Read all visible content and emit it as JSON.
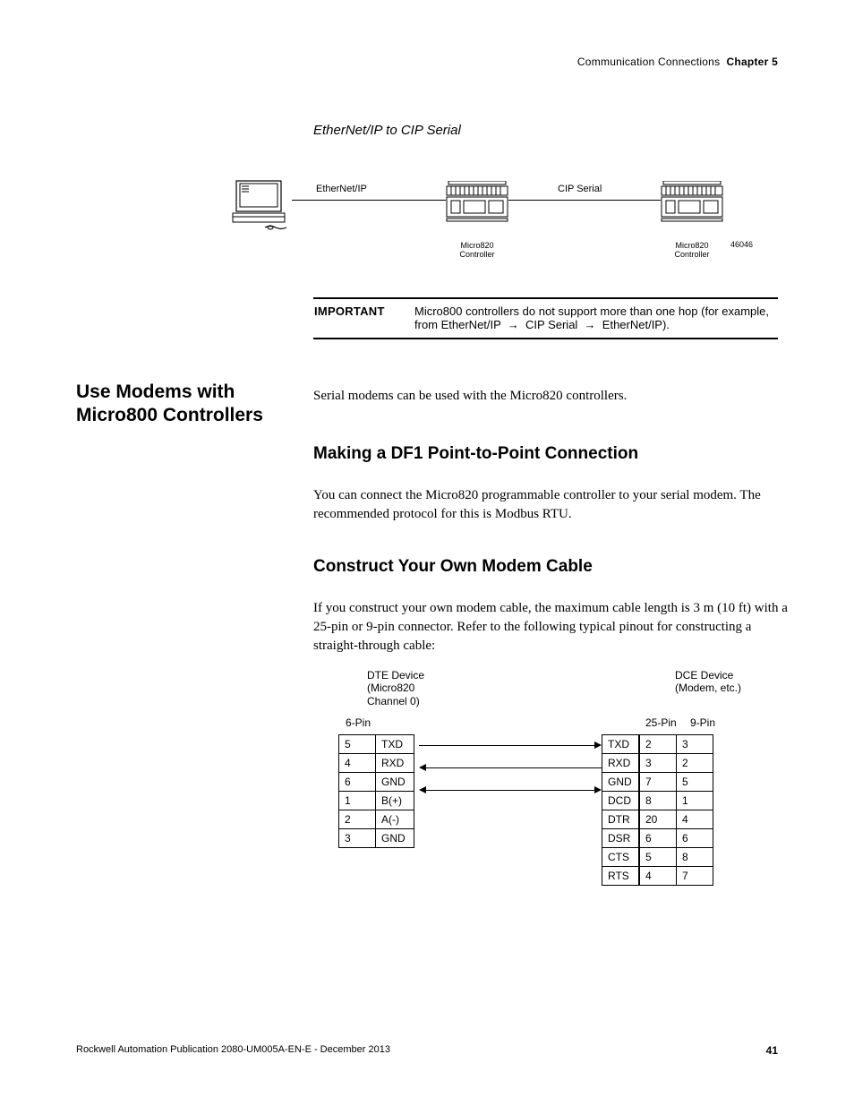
{
  "header": {
    "section": "Communication Connections",
    "chapter_label": "Chapter 5"
  },
  "figure": {
    "title": "EtherNet/IP to CIP Serial",
    "link1": "EtherNet/IP",
    "link2": "CIP Serial",
    "controller_label": "Micro820\nController",
    "ref_id": "46046"
  },
  "important": {
    "label": "IMPORTANT",
    "text_a": "Micro800 controllers do not support more than one hop (for example,",
    "text_b_pre": "from EtherNet/IP ",
    "text_b_mid": " CIP Serial ",
    "text_b_post": " EtherNet/IP)."
  },
  "section": {
    "title": "Use Modems with Micro800 Controllers"
  },
  "intro": "Serial modems can be used with the Micro820 controllers.",
  "h2a": "Making a DF1 Point-to-Point Connection",
  "pa": "You can connect the Micro820 programmable controller to your serial modem. The recommended protocol for this is Modbus RTU.",
  "h2b": "Construct Your Own Modem Cable",
  "pb": "If you construct your own modem cable, the maximum cable length is 3 m (10 ft) with a 25-pin or 9-pin connector. Refer to the following typical pinout for constructing a straight-through cable:",
  "pinout": {
    "dte_label": "DTE Device\n(Micro820\nChannel 0)",
    "dce_label": "DCE Device\n(Modem, etc.)",
    "col_6pin": "6-Pin",
    "col_25pin": "25-Pin",
    "col_9pin": "9-Pin",
    "left_rows": [
      {
        "pin": "5",
        "sig": "TXD"
      },
      {
        "pin": "4",
        "sig": "RXD"
      },
      {
        "pin": "6",
        "sig": "GND"
      },
      {
        "pin": "1",
        "sig": "B(+)"
      },
      {
        "pin": "2",
        "sig": "A(-)"
      },
      {
        "pin": "3",
        "sig": "GND"
      }
    ],
    "mid_rows": [
      "TXD",
      "RXD",
      "GND",
      "DCD",
      "DTR",
      "DSR",
      "CTS",
      "RTS"
    ],
    "right_rows": [
      {
        "p25": "2",
        "p9": "3"
      },
      {
        "p25": "3",
        "p9": "2"
      },
      {
        "p25": "7",
        "p9": "5"
      },
      {
        "p25": "8",
        "p9": "1"
      },
      {
        "p25": "20",
        "p9": "4"
      },
      {
        "p25": "6",
        "p9": "6"
      },
      {
        "p25": "5",
        "p9": "8"
      },
      {
        "p25": "4",
        "p9": "7"
      }
    ]
  },
  "footer": {
    "pubinfo": "Rockwell Automation Publication 2080-UM005A-EN-E - December 2013",
    "page": "41"
  }
}
